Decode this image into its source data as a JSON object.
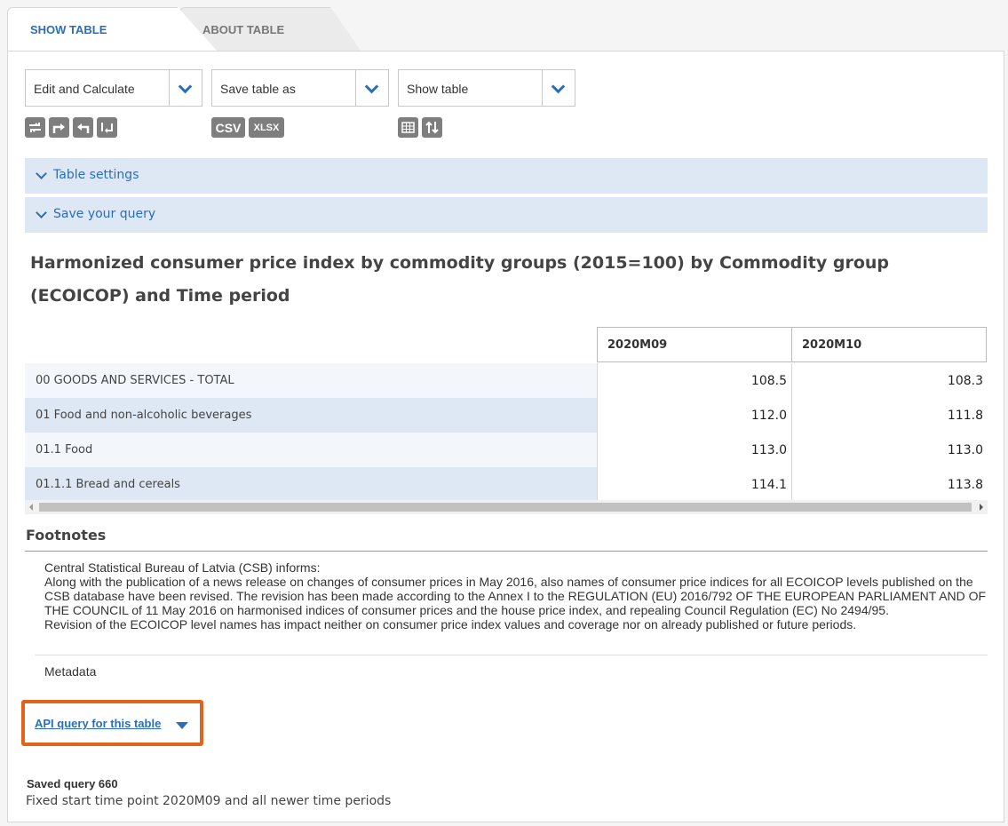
{
  "tabs": [
    {
      "label": "SHOW TABLE",
      "active": true
    },
    {
      "label": "ABOUT TABLE",
      "active": false
    }
  ],
  "toolbar": {
    "dropdowns": [
      {
        "label": "Edit and Calculate"
      },
      {
        "label": "Save table as"
      },
      {
        "label": "Show table"
      }
    ],
    "edit_icons": [
      "pivot-icon",
      "redo-icon",
      "undo-icon",
      "sort-icon"
    ],
    "save_buttons": {
      "csv": "CSV",
      "xlsx": "XLSX"
    },
    "show_icons": [
      "table-view-icon",
      "sort-updown-icon"
    ]
  },
  "accordions": {
    "table_settings": "Table settings",
    "save_query": "Save your query"
  },
  "table": {
    "title": "Harmonized consumer price index by commodity groups (2015=100) by Commodity group (ECOICOP) and Time period",
    "columns": [
      "2020M09",
      "2020M10"
    ],
    "rows": [
      {
        "label": "00 GOODS AND SERVICES - TOTAL",
        "values": [
          "108.5",
          "108.3"
        ]
      },
      {
        "label": "01 Food and non-alcoholic beverages",
        "values": [
          "112.0",
          "111.8"
        ]
      },
      {
        "label": "01.1 Food",
        "values": [
          "113.0",
          "113.0"
        ]
      },
      {
        "label": "01.1.1 Bread and cereals",
        "values": [
          "114.1",
          "113.8"
        ]
      }
    ]
  },
  "footnotes": {
    "title": "Footnotes",
    "lines": [
      "Central Statistical Bureau of Latvia (CSB) informs:",
      "Along with the publication of a news release on changes of consumer prices in May 2016, also names of consumer price indices for all ECOICOP levels published on the CSB database have been revised. The revision has been made according to the Annex I to the REGULATION (EU) 2016/792 OF THE EUROPEAN PARLIAMENT AND OF THE COUNCIL of 11 May 2016 on harmonised indices of consumer prices and the house price index, and repealing Council Regulation (EC) No 2494/95.",
      "Revision of the ECOICOP level names has impact neither on consumer price index values and coverage nor on already published or future periods."
    ],
    "metadata": "Metadata"
  },
  "api": {
    "link_label": "API query for this table"
  },
  "saved_query": {
    "title": "Saved query 660",
    "description": "Fixed start time point 2020M09 and all newer time periods"
  },
  "colors": {
    "accent": "#2a6ebb",
    "highlight": "#e0621c",
    "row_band": "#dde8f4"
  }
}
